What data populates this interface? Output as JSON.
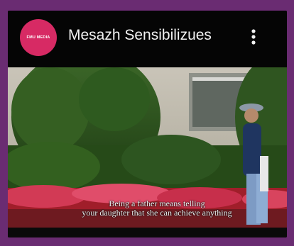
{
  "channel": {
    "avatar_text": "FMU MEDIA",
    "title": "Mesazh Sensibilizues"
  },
  "video": {
    "subtitle_line1": "Being a father means telling",
    "subtitle_line2": "your daughter that she can achieve anything"
  },
  "icons": {
    "menu": "more-vert-icon"
  },
  "colors": {
    "page_border": "#6a2c72",
    "avatar": "#d72a64",
    "header_bg": "#050505"
  }
}
